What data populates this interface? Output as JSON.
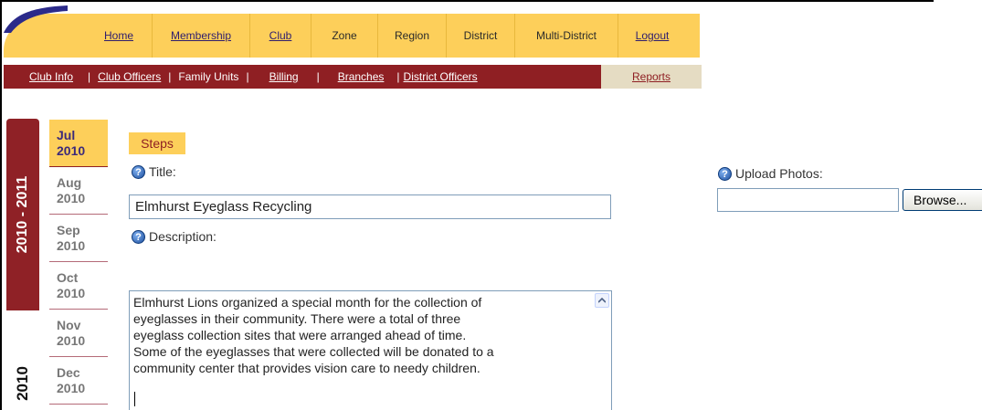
{
  "nav": {
    "items": [
      {
        "label": "Home",
        "link": true
      },
      {
        "label": "Membership",
        "link": true
      },
      {
        "label": "Club",
        "link": true
      },
      {
        "label": "Zone",
        "link": false
      },
      {
        "label": "Region",
        "link": false
      },
      {
        "label": "District",
        "link": false
      },
      {
        "label": "Multi-District",
        "link": false
      },
      {
        "label": "Logout",
        "link": true
      }
    ]
  },
  "subnav": {
    "club_info": "Club Info",
    "club_officers": "Club Officers",
    "family_units": "Family Units",
    "billing": "Billing",
    "branches": "Branches",
    "district_officers": "District Officers",
    "reports": "Reports",
    "sep": "|"
  },
  "fiscal_year": {
    "current": "2010 - 2011",
    "next": "2010"
  },
  "months": [
    {
      "month": "Jul",
      "year": "2010",
      "active": true
    },
    {
      "month": "Aug",
      "year": "2010",
      "active": false
    },
    {
      "month": "Sep",
      "year": "2010",
      "active": false
    },
    {
      "month": "Oct",
      "year": "2010",
      "active": false
    },
    {
      "month": "Nov",
      "year": "2010",
      "active": false
    },
    {
      "month": "Dec",
      "year": "2010",
      "active": false
    }
  ],
  "form": {
    "steps_tab": "Steps",
    "title_label": "Title:",
    "title_value": "Elmhurst Eyeglass Recycling",
    "description_label": "Description:",
    "description_value": "Elmhurst Lions organized a special month for the collection of\neyeglasses in their  community.  There were a total of three\neyeglass collection sites that were arranged ahead of time.\nSome of the eyeglasses that were collected will be donated to  a\ncommunity center that provides vision care to needy children.",
    "upload_label": "Upload Photos:",
    "browse_label": "Browse..."
  },
  "icons": {
    "help": "help-icon",
    "help_glyph": "?"
  },
  "colors": {
    "gold": "#fdcf5a",
    "maroon": "#8f1f23",
    "nav_text": "#3c2a7a"
  }
}
